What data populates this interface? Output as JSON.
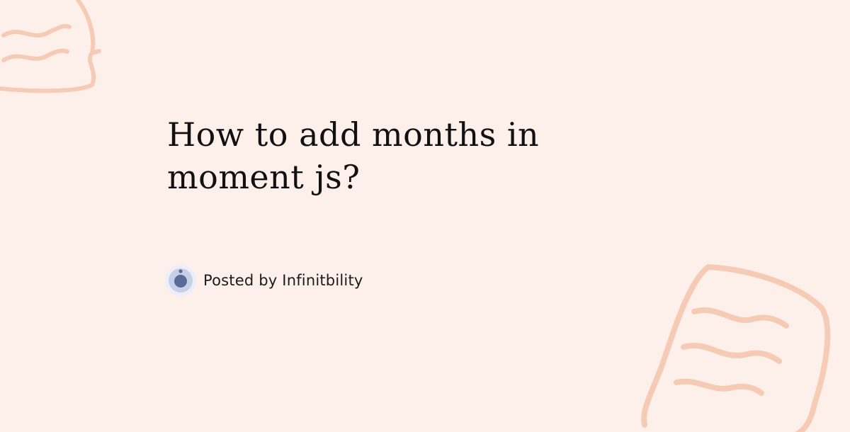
{
  "post": {
    "title": "How to add months in moment js?",
    "byline": "Posted by Infinitbility"
  },
  "theme": {
    "background": "#fdf0eb",
    "decor_color": "#f6c8b0",
    "avatar_outer": "#c7d0e6",
    "avatar_inner": "#5a6b95"
  },
  "icons": {
    "decor": "chat-bubble-doodle",
    "avatar": "avatar-logo"
  }
}
